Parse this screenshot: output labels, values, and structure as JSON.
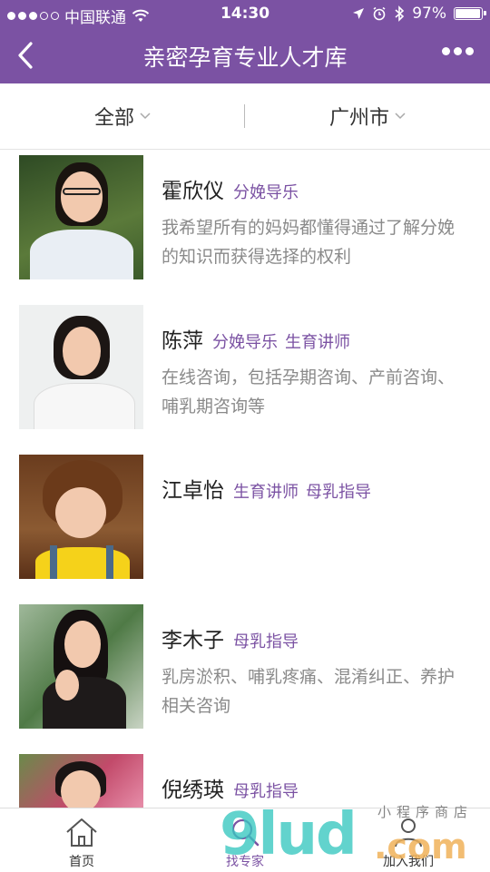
{
  "status_bar": {
    "carrier": "中国联通",
    "time": "14:30",
    "battery": "97%",
    "battery_level": 0.97
  },
  "nav": {
    "title": "亲密孕育专业人才库"
  },
  "filters": {
    "category": "全部",
    "city": "广州市"
  },
  "experts": [
    {
      "name": "霍欣仪",
      "tags": [
        "分娩导乐"
      ],
      "desc": "我希望所有的妈妈都懂得通过了解分娩的知识而获得选择的权利"
    },
    {
      "name": "陈萍",
      "tags": [
        "分娩导乐",
        "生育讲师"
      ],
      "desc": "在线咨询，包括孕期咨询、产前咨询、哺乳期咨询等"
    },
    {
      "name": "江卓怡",
      "tags": [
        "生育讲师",
        "母乳指导"
      ],
      "desc": ""
    },
    {
      "name": "李木子",
      "tags": [
        "母乳指导"
      ],
      "desc": "乳房淤积、哺乳疼痛、混淆纠正、养护相关咨询"
    },
    {
      "name": "倪绣瑛",
      "tags": [
        "母乳指导"
      ],
      "desc": ""
    }
  ],
  "tabs": {
    "home": "首页",
    "find_expert": "找专家",
    "join_us": "加入我们"
  },
  "watermark": {
    "main": "9lud",
    "suffix": ".com",
    "small": "小程序商店"
  },
  "colors": {
    "brand": "#7b52a3",
    "tag": "#7b52a3",
    "desc": "#8a8a8a"
  }
}
